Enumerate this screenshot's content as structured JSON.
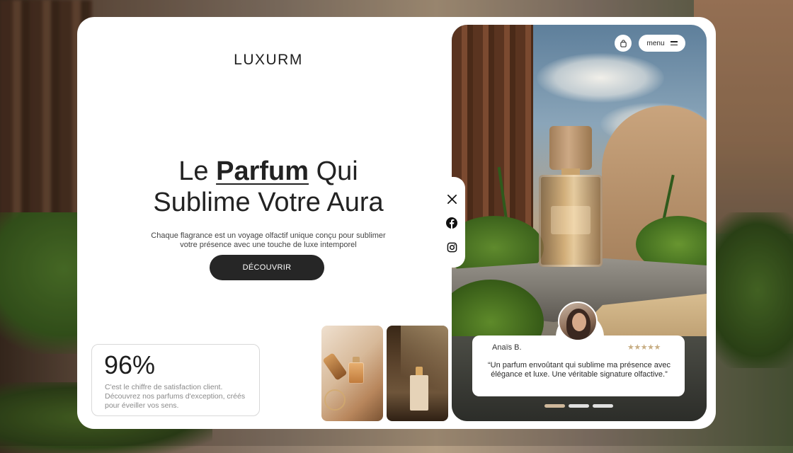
{
  "brand": "LUXURM",
  "hero": {
    "headline_part1": "Le ",
    "headline_emphasis": "Parfum",
    "headline_part2": " Qui",
    "headline_line2": "Sublime Votre Aura",
    "subtitle": "Chaque flagrance est un voyage olfactif unique conçu pour sublimer votre présence avec une touche de luxe intemporel",
    "cta_label": "DÉCOUVRIR"
  },
  "stat": {
    "value": "96%",
    "description": "C'est le chiffre de satisfaction client. Découvrez nos parfums d'exception, créés pour éveiller vos sens."
  },
  "header_actions": {
    "cart_icon": "shopping-bag-icon",
    "menu_label": "menu",
    "menu_icon": "hamburger-icon"
  },
  "social": [
    {
      "name": "x-icon"
    },
    {
      "name": "facebook-icon"
    },
    {
      "name": "instagram-icon"
    }
  ],
  "review": {
    "author": "Anaïs B.",
    "stars": "★★★★★",
    "rating": 5,
    "text": "“Un parfum envoûtant qui sublime ma présence avec élégance et luxe. Une véritable signature olfactive.”"
  },
  "carousel": {
    "count": 3,
    "active": 1
  },
  "colors": {
    "accent_dark": "#262626",
    "star_color": "#c8ae84",
    "card_bg": "#ffffff"
  }
}
